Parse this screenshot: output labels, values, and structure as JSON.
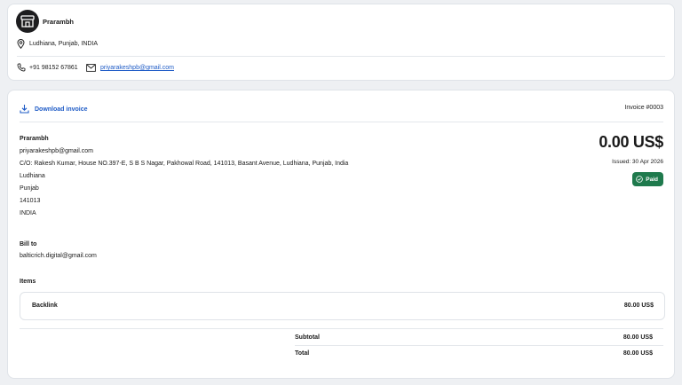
{
  "business": {
    "name": "Prarambh",
    "location": "Ludhiana, Punjab, INDIA",
    "phone": "+91 98152 67861",
    "email": "priyarakeshpb@gmail.com"
  },
  "invoice": {
    "download_label": "Download invoice",
    "number": "Invoice #0003",
    "total": "0.00 US$",
    "issued": "Issued: 30 Apr 2026",
    "status": "Paid",
    "status_color": "#1f7a4d",
    "link_color": "#1e5bc6"
  },
  "from": {
    "name": "Prarambh",
    "lines": [
      "priyarakeshpb@gmail.com",
      "C/O: Rakesh Kumar, House NO.397-E, S B S Nagar, Pakhowal Road, 141013, Basant Avenue, Ludhiana, Punjab, India",
      "Ludhiana",
      "Punjab",
      "141013",
      "INDIA"
    ]
  },
  "bill_to": {
    "label": "Bill to",
    "email": "balticrich.digital@gmail.com"
  },
  "items": {
    "label": "Items",
    "rows": [
      {
        "name": "Backlink",
        "amount": "80.00 US$"
      }
    ]
  },
  "summary": {
    "subtotal_label": "Subtotal",
    "subtotal_value": "80.00 US$",
    "total_label": "Total",
    "total_value": "80.00 US$"
  }
}
